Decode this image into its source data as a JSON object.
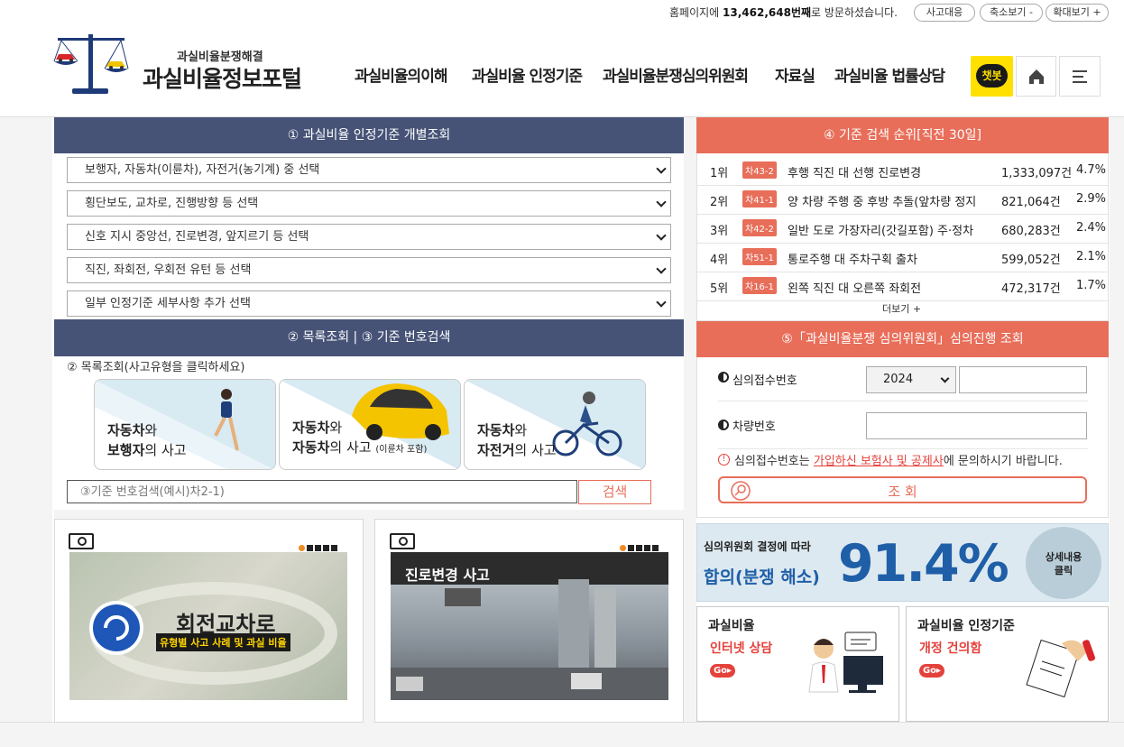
{
  "topbar": {
    "visit_prefix": "홈페이지에",
    "visit_count": "13,462,648번째",
    "visit_suffix": "로 방문하셨습니다.",
    "buttons": [
      "사고대응",
      "축소보기 -",
      "확대보기 +"
    ]
  },
  "logo": {
    "subtitle": "과실비율분쟁해결",
    "title": "과실비율정보포털"
  },
  "nav": [
    "과실비율의이해",
    "과실비율 인정기준",
    "과실비율분쟁심의위원회",
    "자료실",
    "과실비율 법률상담"
  ],
  "chatbot_label": "챗봇",
  "panel1": {
    "title": "① 과실비율 인정기준 개별조회",
    "selects": [
      "보행자, 자동차(이륜차), 자전거(농기계) 중 선택",
      "횡단보도, 교차로, 진행방향 등 선택",
      "신호 지시 중앙선, 진로변경, 앞지르기 등 선택",
      "직진, 좌회전, 우회전 유턴 등 선택",
      "일부 인정기준 세부사항 추가 선택"
    ]
  },
  "panel2": {
    "title": "② 목록조회 | ③ 기준 번호검색",
    "list_label": "② 목록조회(사고유형을 클릭하세요)",
    "cards": [
      {
        "a": "자동차",
        "b": "와",
        "c": "보행자",
        "d": "의 사고",
        "note": ""
      },
      {
        "a": "자동차",
        "b": "와",
        "c": "자동차",
        "d": "의 사고",
        "note": "(이륜차 포함)"
      },
      {
        "a": "자동차",
        "b": "와",
        "c": "자전거",
        "d": "의 사고",
        "note": ""
      }
    ],
    "search_placeholder": "③기준 번호검색(예시)차2-1)",
    "search_button": "검색"
  },
  "panel4": {
    "title": "④ 기준 검색 순위[직전 30일]",
    "rows": [
      {
        "rank": "1위",
        "code": "차43-2",
        "name": "후행 직진 대 선행 진로변경",
        "count": "1,333,097건",
        "pct": "4.7%"
      },
      {
        "rank": "2위",
        "code": "차41-1",
        "name": "양 차량 주행 중 후방 추돌(앞차량 정지",
        "count": "821,064건",
        "pct": "2.9%"
      },
      {
        "rank": "3위",
        "code": "차42-2",
        "name": "일반 도로 가장자리(갓길포함) 주·정차",
        "count": "680,283건",
        "pct": "2.4%"
      },
      {
        "rank": "4위",
        "code": "차51-1",
        "name": "통로주행 대 주차구획 출차",
        "count": "599,052건",
        "pct": "2.1%"
      },
      {
        "rank": "5위",
        "code": "차16-1",
        "name": "왼쪽 직진 대 오른쪽 좌회전",
        "count": "472,317건",
        "pct": "1.7%"
      }
    ],
    "more": "더보기 +"
  },
  "panel5": {
    "title": "⑤「과실비율분쟁 심의위원회」심의진행 조회",
    "receipt_label": "심의접수번호",
    "year": "2024",
    "car_label": "차량번호",
    "notice_pre": "심의접수번호는 ",
    "notice_link": "가입하신 보험사 및 공제사",
    "notice_post": "에 문의하시기 바랍니다.",
    "query_button": "조 회"
  },
  "videos": [
    {
      "title": "회전교차로",
      "subtitle": "유형별 사고 사례 및 과실 비율"
    },
    {
      "title": "진로변경 사고",
      "subtitle": ""
    }
  ],
  "stat": {
    "line1": "심의위원회 결정에 따라",
    "line2": "합의(분쟁 해소)",
    "value": "91.4%",
    "detail": "상세내용\n클릭",
    "value_fraction": 0.914
  },
  "bottom_cards": [
    {
      "title": "과실비율",
      "sub": "인터넷 상담",
      "go": "Go"
    },
    {
      "title": "과실비율 인정기준",
      "sub": "개정 건의함",
      "go": "Go"
    }
  ],
  "colors": {
    "navy": "#465377",
    "coral": "#e86e5a",
    "stat_blue": "#1f5fa8",
    "go_red": "#e5413b"
  }
}
